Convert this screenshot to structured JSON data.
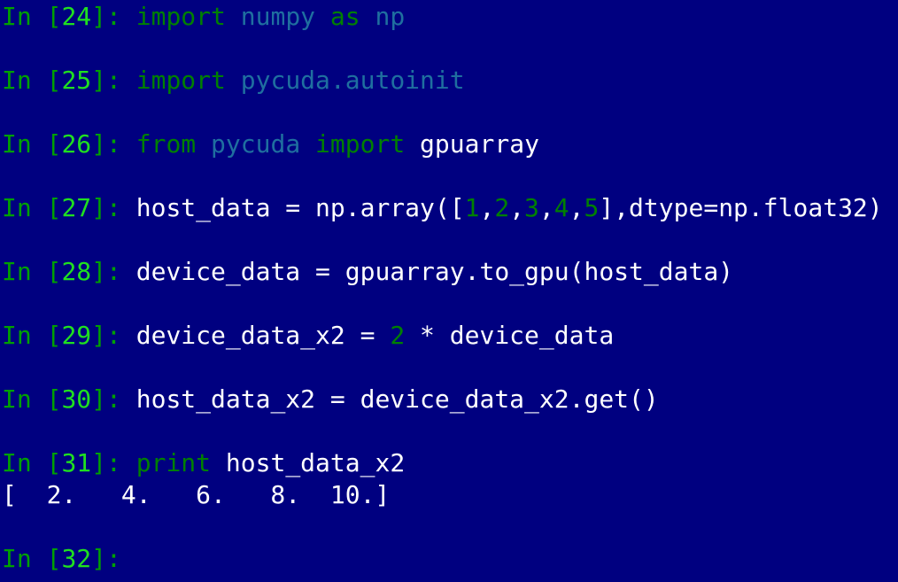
{
  "terminal": {
    "lines": [
      {
        "prompt_in": "In",
        "prompt_open": " [",
        "prompt_num": "24",
        "prompt_close": "]: ",
        "segments": [
          {
            "text": "import",
            "cls": "kw"
          },
          {
            "text": " ",
            "cls": "plain"
          },
          {
            "text": "numpy",
            "cls": "mod"
          },
          {
            "text": " ",
            "cls": "plain"
          },
          {
            "text": "as",
            "cls": "kw"
          },
          {
            "text": " ",
            "cls": "plain"
          },
          {
            "text": "np",
            "cls": "mod"
          }
        ]
      },
      {
        "prompt_in": "In",
        "prompt_open": " [",
        "prompt_num": "25",
        "prompt_close": "]: ",
        "segments": [
          {
            "text": "import",
            "cls": "kw"
          },
          {
            "text": " ",
            "cls": "plain"
          },
          {
            "text": "pycuda.autoinit",
            "cls": "mod"
          }
        ]
      },
      {
        "prompt_in": "In",
        "prompt_open": " [",
        "prompt_num": "26",
        "prompt_close": "]: ",
        "segments": [
          {
            "text": "from",
            "cls": "kw"
          },
          {
            "text": " ",
            "cls": "plain"
          },
          {
            "text": "pycuda",
            "cls": "mod"
          },
          {
            "text": " ",
            "cls": "plain"
          },
          {
            "text": "import",
            "cls": "kw"
          },
          {
            "text": " gpuarray",
            "cls": "plain"
          }
        ]
      },
      {
        "prompt_in": "In",
        "prompt_open": " [",
        "prompt_num": "27",
        "prompt_close": "]: ",
        "segments": [
          {
            "text": "host_data = np.array([",
            "cls": "plain"
          },
          {
            "text": "1",
            "cls": "num"
          },
          {
            "text": ",",
            "cls": "plain"
          },
          {
            "text": "2",
            "cls": "num"
          },
          {
            "text": ",",
            "cls": "plain"
          },
          {
            "text": "3",
            "cls": "num"
          },
          {
            "text": ",",
            "cls": "plain"
          },
          {
            "text": "4",
            "cls": "num"
          },
          {
            "text": ",",
            "cls": "plain"
          },
          {
            "text": "5",
            "cls": "num"
          },
          {
            "text": "],dtype=np.float32)",
            "cls": "plain"
          }
        ]
      },
      {
        "prompt_in": "In",
        "prompt_open": " [",
        "prompt_num": "28",
        "prompt_close": "]: ",
        "segments": [
          {
            "text": "device_data = gpuarray.to_gpu(host_data)",
            "cls": "plain"
          }
        ]
      },
      {
        "prompt_in": "In",
        "prompt_open": " [",
        "prompt_num": "29",
        "prompt_close": "]: ",
        "segments": [
          {
            "text": "device_data_x2 = ",
            "cls": "plain"
          },
          {
            "text": "2",
            "cls": "num"
          },
          {
            "text": " * device_data",
            "cls": "plain"
          }
        ]
      },
      {
        "prompt_in": "In",
        "prompt_open": " [",
        "prompt_num": "30",
        "prompt_close": "]: ",
        "segments": [
          {
            "text": "host_data_x2 = device_data_x2.get()",
            "cls": "plain"
          }
        ]
      },
      {
        "prompt_in": "In",
        "prompt_open": " [",
        "prompt_num": "31",
        "prompt_close": "]: ",
        "segments": [
          {
            "text": "print",
            "cls": "kw"
          },
          {
            "text": " host_data_x2",
            "cls": "plain"
          }
        ]
      },
      {
        "output": "[  2.   4.   6.   8.  10.]"
      },
      {
        "prompt_in": "In",
        "prompt_open": " [",
        "prompt_num": "32",
        "prompt_close": "]: ",
        "segments": []
      }
    ]
  }
}
